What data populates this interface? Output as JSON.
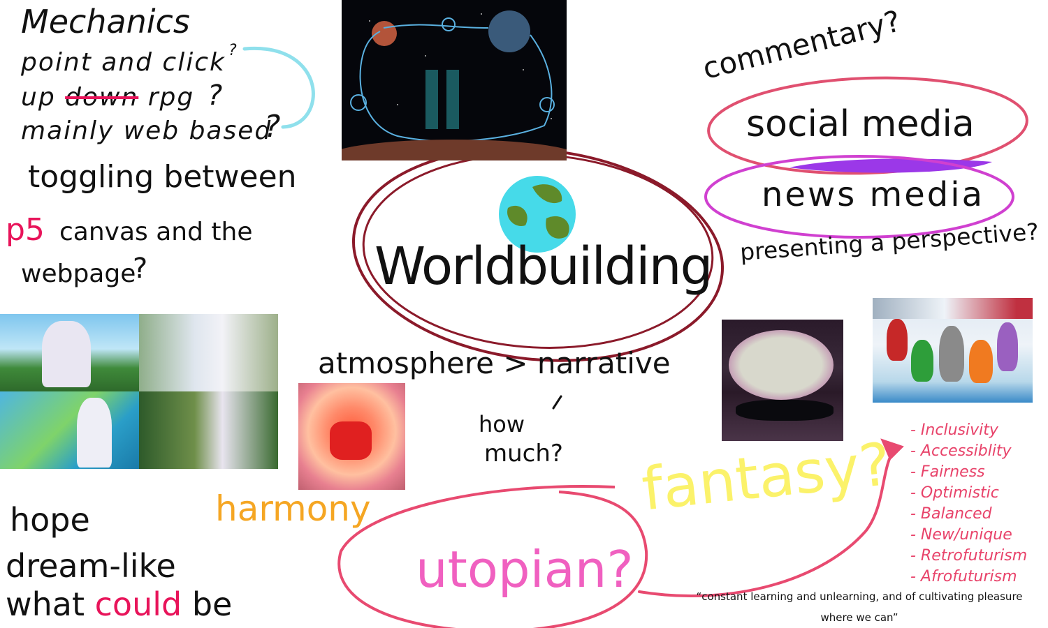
{
  "mechanics": {
    "title": "Mechanics",
    "line1": "point and click",
    "line1_q": "?",
    "line2_a": "up ",
    "line2_struck": "down",
    "line2_b": " rpg",
    "line2_q": "?",
    "line3": "mainly web based",
    "line3_q": "?"
  },
  "toggling": {
    "line1": "toggling between",
    "p5": "p5",
    "line2": "canvas and the",
    "line3": "webpage",
    "q": "?"
  },
  "center": {
    "title": "Worldbuilding",
    "atmosphere": "atmosphere > narrative",
    "how": "how",
    "much": "much?"
  },
  "commentary": {
    "title": "commentary?",
    "social": "social media",
    "news": "news media",
    "presenting": "presenting a perspective?"
  },
  "bottom_left": {
    "hope": "hope",
    "dream": "dream-like",
    "what": "what",
    "could": "could",
    "be": "be"
  },
  "harmony": "harmony",
  "utopian": "utopian?",
  "fantasy": "fantasy?",
  "values_list": [
    "- Inclusivity",
    "- Accessiblity",
    "- Fairness",
    "- Optimistic",
    "- Balanced",
    "- New/unique",
    "- Retrofuturism",
    "- Afrofuturism"
  ],
  "quote": {
    "line1": "“constant learning and unlearning, and of cultivating pleasure",
    "line2": "where we can”"
  },
  "colors": {
    "ink": "#111111",
    "red": "#e8145a",
    "pink": "#f060c0",
    "dark_red": "#8b1a2a",
    "orange": "#f5a623",
    "yellow": "#fbf26a",
    "cyan": "#8fe0ec",
    "list_red": "#e8436a",
    "social_ellipse": "#e05070",
    "news_ellipse": "#d040d0",
    "purple_fill": "#9b38e8"
  }
}
